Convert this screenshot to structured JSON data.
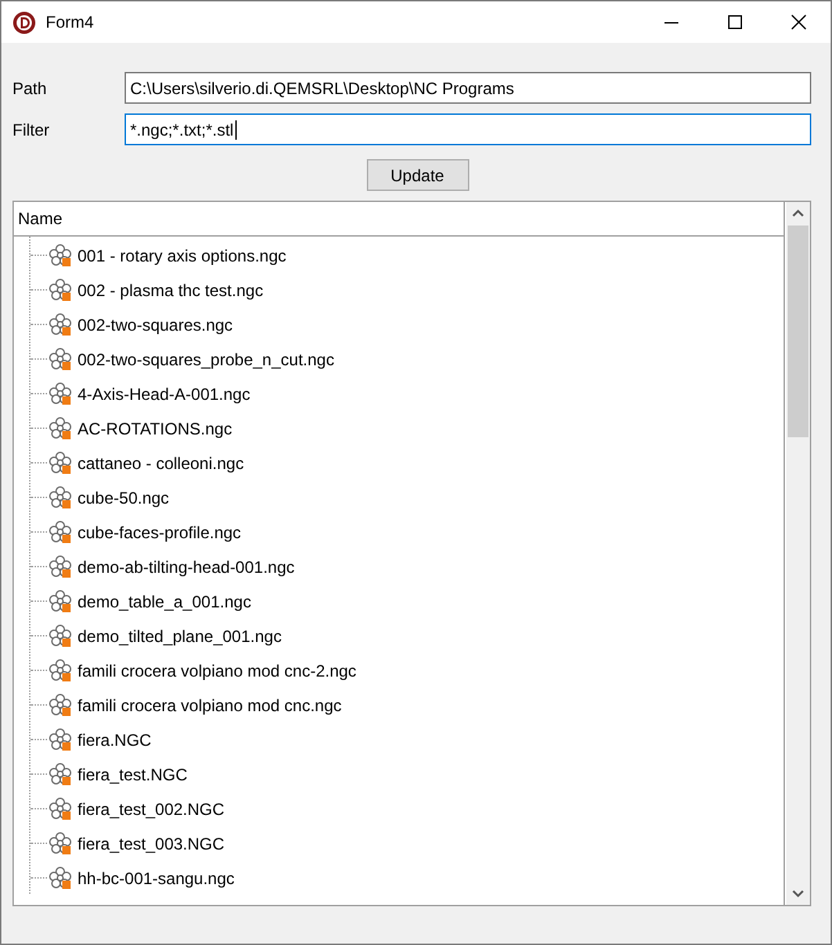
{
  "window": {
    "title": "Form4"
  },
  "fields": [
    {
      "label": "Path",
      "value": "C:\\Users\\silverio.di.QEMSRL\\Desktop\\NC Programs",
      "focused": false
    },
    {
      "label": "Filter",
      "value": "*.ngc;*.txt;*.stl",
      "focused": true
    }
  ],
  "update_button": "Update",
  "tree": {
    "column": "Name",
    "items": [
      "001 - rotary axis options.ngc",
      "002 - plasma thc test.ngc",
      "002-two-squares.ngc",
      "002-two-squares_probe_n_cut.ngc",
      "4-Axis-Head-A-001.ngc",
      "AC-ROTATIONS.ngc",
      "cattaneo  - colleoni.ngc",
      "cube-50.ngc",
      "cube-faces-profile.ngc",
      "demo-ab-tilting-head-001.ngc",
      "demo_table_a_001.ngc",
      "demo_tilted_plane_001.ngc",
      "famili crocera volpiano mod cnc-2.ngc",
      "famili crocera volpiano mod cnc.ngc",
      "fiera.NGC",
      "fiera_test.NGC",
      "fiera_test_002.NGC",
      "fiera_test_003.NGC",
      "hh-bc-001-sangu.ngc"
    ]
  }
}
